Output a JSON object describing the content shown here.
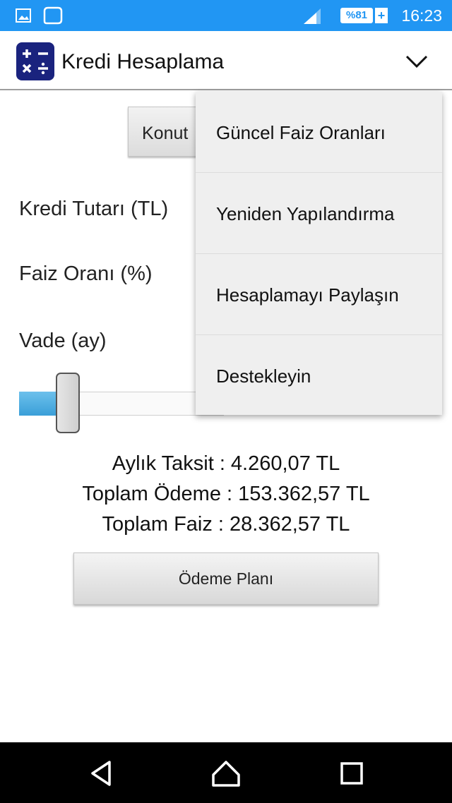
{
  "status_bar": {
    "battery": "%81",
    "battery_plus": "+",
    "time": "16:23",
    "icons": [
      "image-icon",
      "chat-icon",
      "signal-icon",
      "battery-icon"
    ]
  },
  "app_bar": {
    "title": "Kredi Hesaplama",
    "logo_icon": "calculator-icon",
    "menu_icon": "chevron-down-icon"
  },
  "form": {
    "type_button": "Konut",
    "loan_amount_label": "Kredi Tutarı (TL)",
    "interest_rate_label": "Faiz Oranı (%)",
    "term_label": "Vade (ay)",
    "term_slider_fraction": 0.2
  },
  "results": {
    "monthly_installment": "Aylık Taksit : 4.260,07 TL",
    "total_payment": "Toplam Ödeme : 153.362,57 TL",
    "total_interest": "Toplam Faiz : 28.362,57 TL"
  },
  "plan_button": "Ödeme Planı",
  "overflow_menu": {
    "items": [
      {
        "label": "Güncel Faiz Oranları"
      },
      {
        "label": "Yeniden Yapılandırma"
      },
      {
        "label": "Hesaplamayı Paylaşın"
      },
      {
        "label": "Destekleyin"
      }
    ]
  },
  "nav_bar": {
    "icons": [
      "back-icon",
      "home-icon",
      "recents-icon"
    ]
  },
  "colors": {
    "status_bar": "#2196f3",
    "slider_fill": "#3a9fd8",
    "logo_bg": "#1a237e"
  }
}
